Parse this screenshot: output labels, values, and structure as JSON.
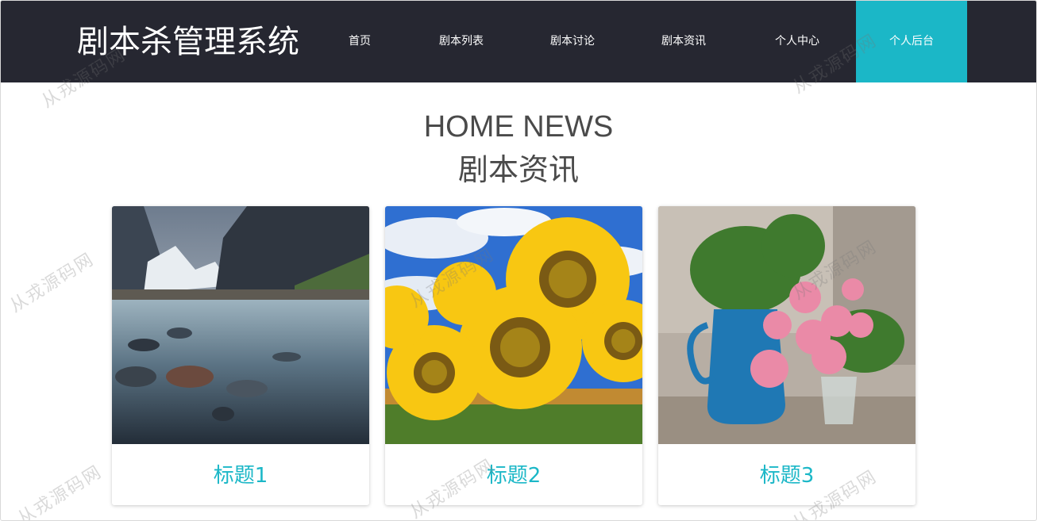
{
  "header": {
    "brand": "剧本杀管理系统",
    "nav": [
      {
        "label": "首页"
      },
      {
        "label": "剧本列表"
      },
      {
        "label": "剧本讨论"
      },
      {
        "label": "剧本资讯"
      },
      {
        "label": "个人中心"
      },
      {
        "label": "个人后台",
        "active": true
      }
    ]
  },
  "section": {
    "title_en": "HOME NEWS",
    "title_cn": "剧本资讯"
  },
  "cards": [
    {
      "title": "标题1",
      "image": "mountain-river-photo"
    },
    {
      "title": "标题2",
      "image": "sunflowers-photo"
    },
    {
      "title": "标题3",
      "image": "pink-roses-blue-jug-photo"
    }
  ],
  "watermark": "从戎源码网",
  "colors": {
    "header_bg": "#262731",
    "accent": "#1bb7c7",
    "heading_text": "#4a4a4a"
  }
}
